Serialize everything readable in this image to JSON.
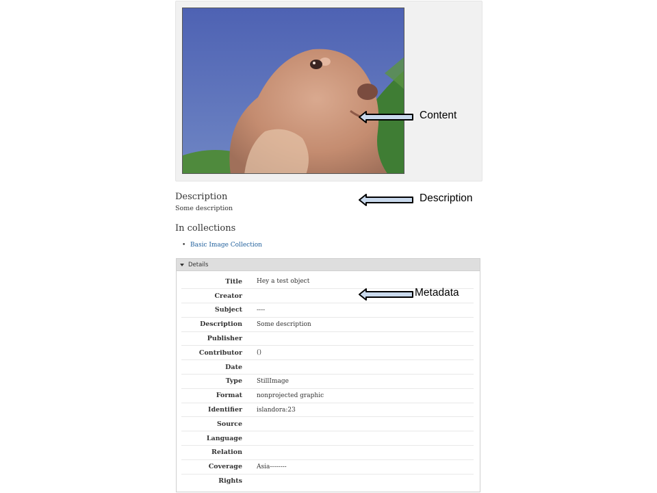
{
  "content": {
    "image_alt": "prairie dog photo"
  },
  "description": {
    "heading": "Description",
    "text": "Some description"
  },
  "collections": {
    "heading": "In collections",
    "items": [
      {
        "label": "Basic Image Collection"
      }
    ]
  },
  "details": {
    "label": "Details",
    "rows": [
      {
        "label": "Title",
        "value": "Hey a test object"
      },
      {
        "label": "Creator",
        "value": ""
      },
      {
        "label": "Subject",
        "value": "----"
      },
      {
        "label": "Description",
        "value": "Some description"
      },
      {
        "label": "Publisher",
        "value": ""
      },
      {
        "label": "Contributor",
        "value": "()"
      },
      {
        "label": "Date",
        "value": ""
      },
      {
        "label": "Type",
        "value": "StillImage"
      },
      {
        "label": "Format",
        "value": "nonprojected graphic"
      },
      {
        "label": "Identifier",
        "value": "islandora:23"
      },
      {
        "label": "Source",
        "value": ""
      },
      {
        "label": "Language",
        "value": ""
      },
      {
        "label": "Relation",
        "value": ""
      },
      {
        "label": "Coverage",
        "value": "Asia--------"
      },
      {
        "label": "Rights",
        "value": ""
      }
    ]
  },
  "annotations": {
    "content": "Content",
    "description": "Description",
    "metadata": "Metadata"
  },
  "colors": {
    "link": "#1f5f9c",
    "panel_background": "#f1f1f1",
    "details_header": "#dedede",
    "arrow_fill": "#c9d9ec"
  }
}
